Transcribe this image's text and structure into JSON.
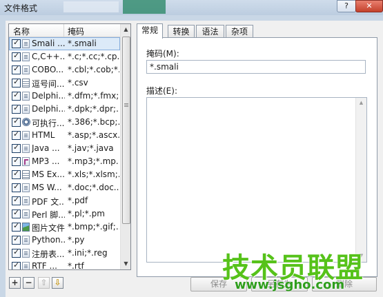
{
  "window": {
    "title": "文件格式",
    "help_label": "?",
    "close_label": "✕"
  },
  "list": {
    "headers": {
      "name": "名称",
      "encoding": "掩码"
    },
    "items": [
      {
        "name": "Smali ...",
        "mask": "*.smali",
        "icon": "file-icon",
        "checked": true,
        "selected": true
      },
      {
        "name": "C,C++...",
        "mask": "*.c;*.cc;*.cp...",
        "icon": "file-icon",
        "checked": true
      },
      {
        "name": "COBO...",
        "mask": "*.cbl;*.cob;*...",
        "icon": "file-icon",
        "checked": true
      },
      {
        "name": "逗号间...",
        "mask": "*.csv",
        "icon": "table-icon",
        "checked": true
      },
      {
        "name": "Delphi...",
        "mask": "*.dfm;*.fmx;...",
        "icon": "file-icon",
        "checked": true
      },
      {
        "name": "Delphi...",
        "mask": "*.dpk;*.dpr;...",
        "icon": "file-icon",
        "checked": true
      },
      {
        "name": "可执行...",
        "mask": "*.386;*.bcp;...",
        "icon": "gear-icon",
        "checked": true
      },
      {
        "name": "HTML",
        "mask": "*.asp;*.ascx...",
        "icon": "file-icon",
        "checked": true
      },
      {
        "name": "Java ...",
        "mask": "*.jav;*.java",
        "icon": "file-icon",
        "checked": true
      },
      {
        "name": "MP3 ...",
        "mask": "*.mp3;*.mp...",
        "icon": "music-icon",
        "checked": true
      },
      {
        "name": "MS Ex...",
        "mask": "*.xls;*.xlsm;...",
        "icon": "table-icon",
        "checked": true
      },
      {
        "name": "MS W...",
        "mask": "*.doc;*.doc...",
        "icon": "file-icon",
        "checked": true
      },
      {
        "name": "PDF 文...",
        "mask": "*.pdf",
        "icon": "file-icon",
        "checked": true
      },
      {
        "name": "Perl 脚...",
        "mask": "*.pl;*.pm",
        "icon": "file-icon",
        "checked": true
      },
      {
        "name": "图片文件",
        "mask": "*.bmp;*.gif;...",
        "icon": "image-icon",
        "checked": true
      },
      {
        "name": "Python...",
        "mask": "*.py",
        "icon": "file-icon",
        "checked": true
      },
      {
        "name": "注册表...",
        "mask": "*.ini;*.reg",
        "icon": "file-icon",
        "checked": true
      },
      {
        "name": "RTF ...",
        "mask": "*.rtf",
        "icon": "file-icon",
        "checked": true
      }
    ],
    "scroll_up": "▲",
    "scroll_down": "▼",
    "tools": {
      "add": "+",
      "remove": "−",
      "up": "⇧",
      "down": "⇩"
    }
  },
  "tabs": [
    "常规",
    "转换",
    "语法",
    "杂项"
  ],
  "general": {
    "mask_label": "掩码(M):",
    "mask_value": "*.smali",
    "desc_label": "描述(E):",
    "desc_value": ""
  },
  "buttons": {
    "save": "保存",
    "other": "另存为",
    "delete": "删除"
  },
  "watermark": {
    "main": "技术员联盟",
    "url": "www.jsgho.com"
  }
}
